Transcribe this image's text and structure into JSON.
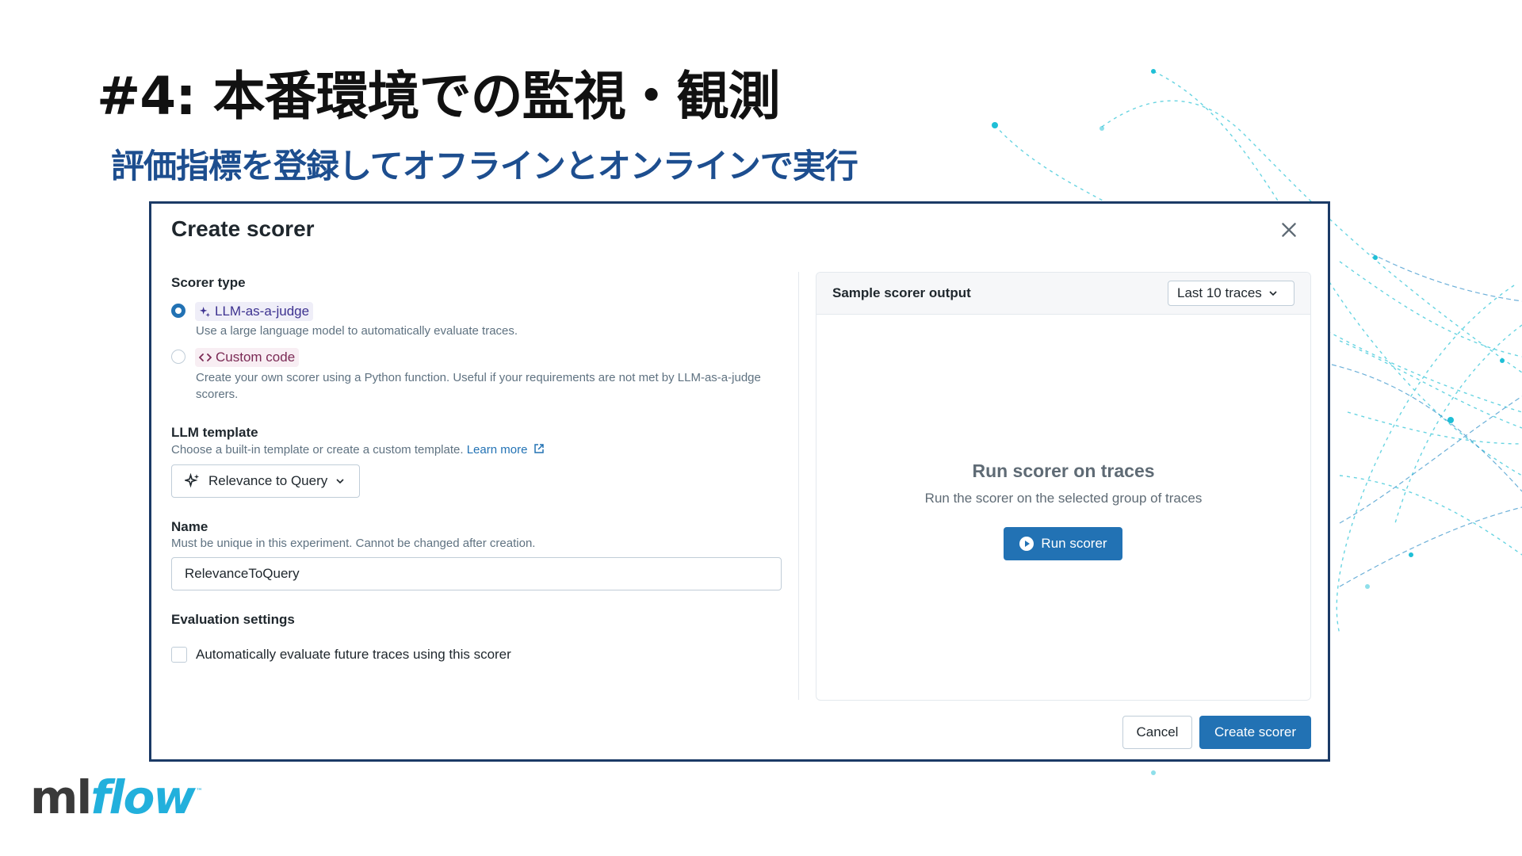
{
  "slide": {
    "title": "#4: 本番環境での監視・観測",
    "subtitle": "評価指標を登録してオフラインとオンラインで実行"
  },
  "dialog": {
    "title": "Create scorer",
    "scorer_type": {
      "label": "Scorer type",
      "options": [
        {
          "label": "LLM-as-a-judge",
          "description": "Use a large language model to automatically evaluate traces.",
          "selected": true,
          "icon": "sparkle-icon"
        },
        {
          "label": "Custom code",
          "description": "Create your own scorer using a Python function. Useful if your requirements are not met by LLM-as-a-judge scorers.",
          "selected": false,
          "icon": "code-icon"
        }
      ]
    },
    "llm_template": {
      "label": "LLM template",
      "help": "Choose a built-in template or create a custom template.",
      "learn_more": "Learn more",
      "selected": "Relevance to Query"
    },
    "name": {
      "label": "Name",
      "help": "Must be unique in this experiment. Cannot be changed after creation.",
      "value": "RelevanceToQuery"
    },
    "evaluation": {
      "label": "Evaluation settings",
      "checkbox_label": "Automatically evaluate future traces using this scorer",
      "checked": false
    },
    "sample_output": {
      "title": "Sample scorer output",
      "traces_select": "Last 10 traces",
      "empty_title": "Run scorer on traces",
      "empty_desc": "Run the scorer on the selected group of traces",
      "run_button": "Run scorer"
    },
    "footer": {
      "cancel": "Cancel",
      "create": "Create scorer"
    }
  },
  "logo": {
    "ml": "ml",
    "flow": "flow",
    "tm": "™"
  },
  "colors": {
    "accent": "#2272b4",
    "subtitle": "#1d4e8f",
    "frame": "#1b3a66",
    "logo": "#22b0dc"
  }
}
